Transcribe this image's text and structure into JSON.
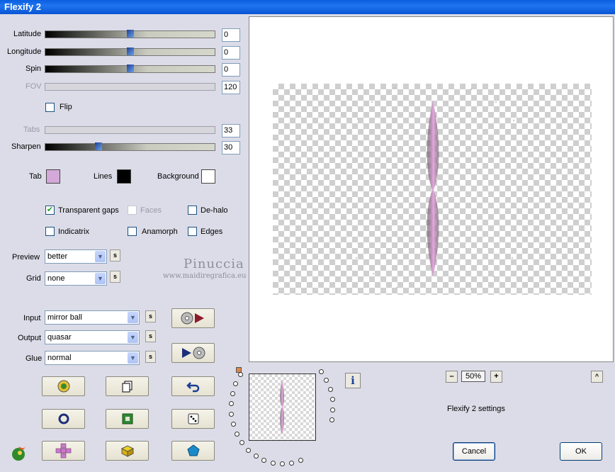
{
  "window": {
    "title": "Flexify 2"
  },
  "sliders": [
    {
      "label": "Latitude",
      "value": "0",
      "level": 0.5,
      "enabled": true
    },
    {
      "label": "Longitude",
      "value": "0",
      "level": 0.5,
      "enabled": true
    },
    {
      "label": "Spin",
      "value": "0",
      "level": 0.5,
      "enabled": true
    },
    {
      "label": "FOV",
      "value": "120",
      "level": 0.0,
      "enabled": false
    },
    {
      "label": "Tabs",
      "value": "33",
      "level": 0.0,
      "enabled": false
    },
    {
      "label": "Sharpen",
      "value": "30",
      "level": 0.3,
      "enabled": true
    }
  ],
  "flip": {
    "label": "Flip",
    "checked": false
  },
  "colors": {
    "tab": {
      "label": "Tab",
      "value": "#d4a8d8"
    },
    "lines": {
      "label": "Lines",
      "value": "#000000"
    },
    "background": {
      "label": "Background",
      "value": "#ffffff"
    }
  },
  "options": {
    "transparent_gaps": {
      "label": "Transparent gaps",
      "checked": true
    },
    "faces": {
      "label": "Faces",
      "checked": false
    },
    "de_halo": {
      "label": "De-halo",
      "checked": false
    },
    "indicatrix": {
      "label": "Indicatrix",
      "checked": false
    },
    "anamorph": {
      "label": "Anamorph",
      "checked": false
    },
    "edges": {
      "label": "Edges",
      "checked": false
    }
  },
  "preview_quality": {
    "label": "Preview",
    "value": "better"
  },
  "grid": {
    "label": "Grid",
    "value": "none"
  },
  "input": {
    "label": "Input",
    "value": "mirror ball"
  },
  "output": {
    "label": "Output",
    "value": "quasar"
  },
  "glue": {
    "label": "Glue",
    "value": "normal"
  },
  "s_button": "s",
  "zoom": {
    "value": "50%",
    "minus": "–",
    "plus": "+",
    "up": "^"
  },
  "info_button": "i",
  "status": "Flexify 2 settings",
  "buttons": {
    "cancel": "Cancel",
    "ok": "OK"
  },
  "watermark": {
    "name": "Pinuccia",
    "url": "www.maidiregrafica.eu"
  }
}
